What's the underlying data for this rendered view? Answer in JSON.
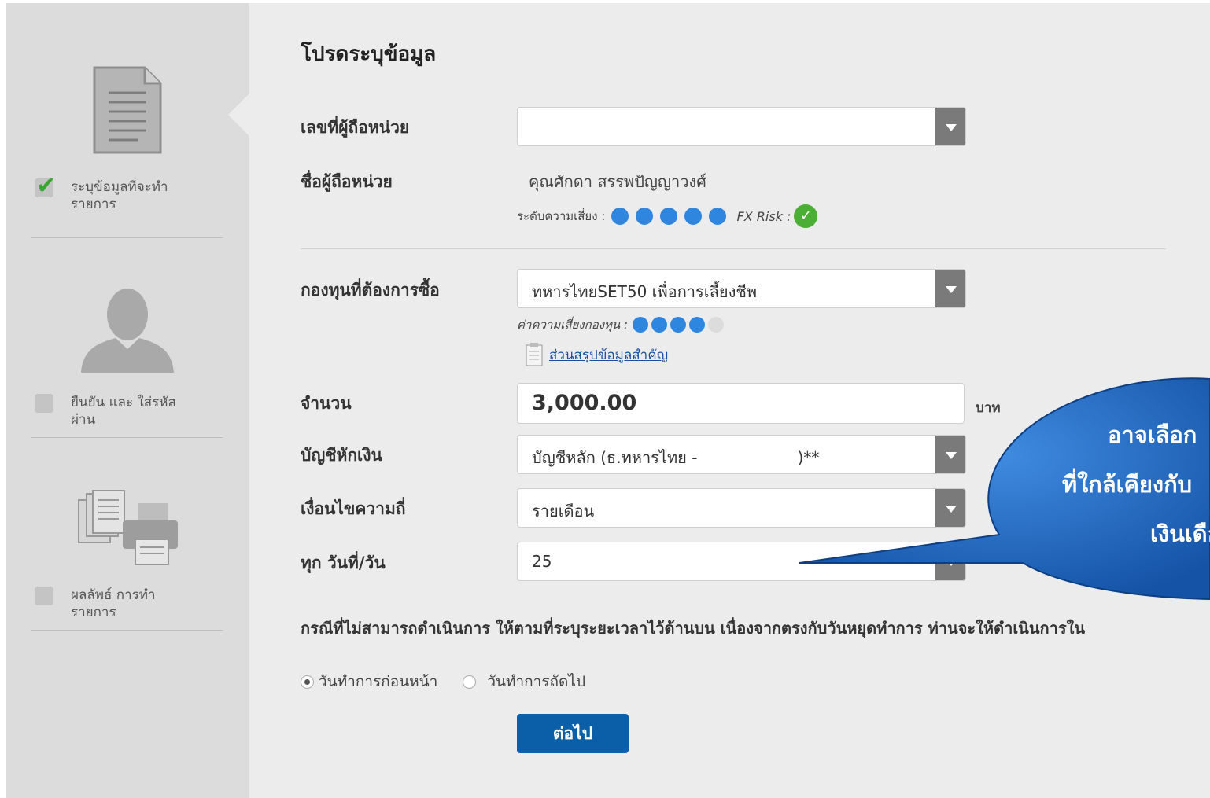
{
  "sidebar": {
    "steps": [
      {
        "label": "ระบุข้อมูลที่จะทำรายการ",
        "checked": true
      },
      {
        "label": "ยืนยัน และ ใส่รหัสผ่าน",
        "checked": false
      },
      {
        "label": "ผลลัพธ์ การทำรายการ",
        "checked": false
      }
    ]
  },
  "form": {
    "title": "โปรดระบุข้อมูล",
    "holder_no_label": "เลขที่ผู้ถือหน่วย",
    "holder_no_value": "",
    "holder_name_label": "ชื่อผู้ถือหน่วย",
    "holder_name_value": "คุณศักดา สรรพปัญญาวงศ์",
    "risk_label": "ระดับความเสี่ยง :",
    "risk_level": 5,
    "fx_risk_label": "FX Risk :",
    "fund_label": "กองทุนที่ต้องการซื้อ",
    "fund_value": "ทหารไทยSET50 เพื่อการเลี้ยงชีพ",
    "fund_risk_label": "ค่าความเสี่ยงกองทุน :",
    "fund_risk_level": 4,
    "summary_link": "ส่วนสรุปข้อมูลสำคัญ",
    "amount_label": "จำนวน",
    "amount_value": "3,000.00",
    "amount_unit": "บาท",
    "account_label": "บัญชีหักเงิน",
    "account_value": "บัญชีหลัก (ธ.ทหารไทย -                    )**",
    "freq_label": "เงื่อนไขความถี่",
    "freq_value": "รายเดือน",
    "day_label": "ทุก วันที่/วัน",
    "day_value": "25",
    "holiday_note": "กรณีที่ไม่สามารถดำเนินการ ให้ตามที่ระบุระยะเวลาไว้ด้านบน เนื่องจากตรงกับวันหยุดทำการ ท่านจะให้ดำเนินการใน",
    "option_prev": "วันทำการก่อนหน้า",
    "option_next": "วันทำการถัดไป",
    "next_button": "ต่อไป"
  },
  "callout": {
    "line1": "อาจเลือก",
    "line2": "ที่ใกล้เคียงกับ",
    "line3": "เงินเดือ"
  },
  "colors": {
    "dot_on": "#2e86de",
    "dot_off": "#dcdcdc",
    "fx_ok": "#4caf35",
    "button": "#0a5fa8",
    "callout": "#1a5fb4"
  }
}
